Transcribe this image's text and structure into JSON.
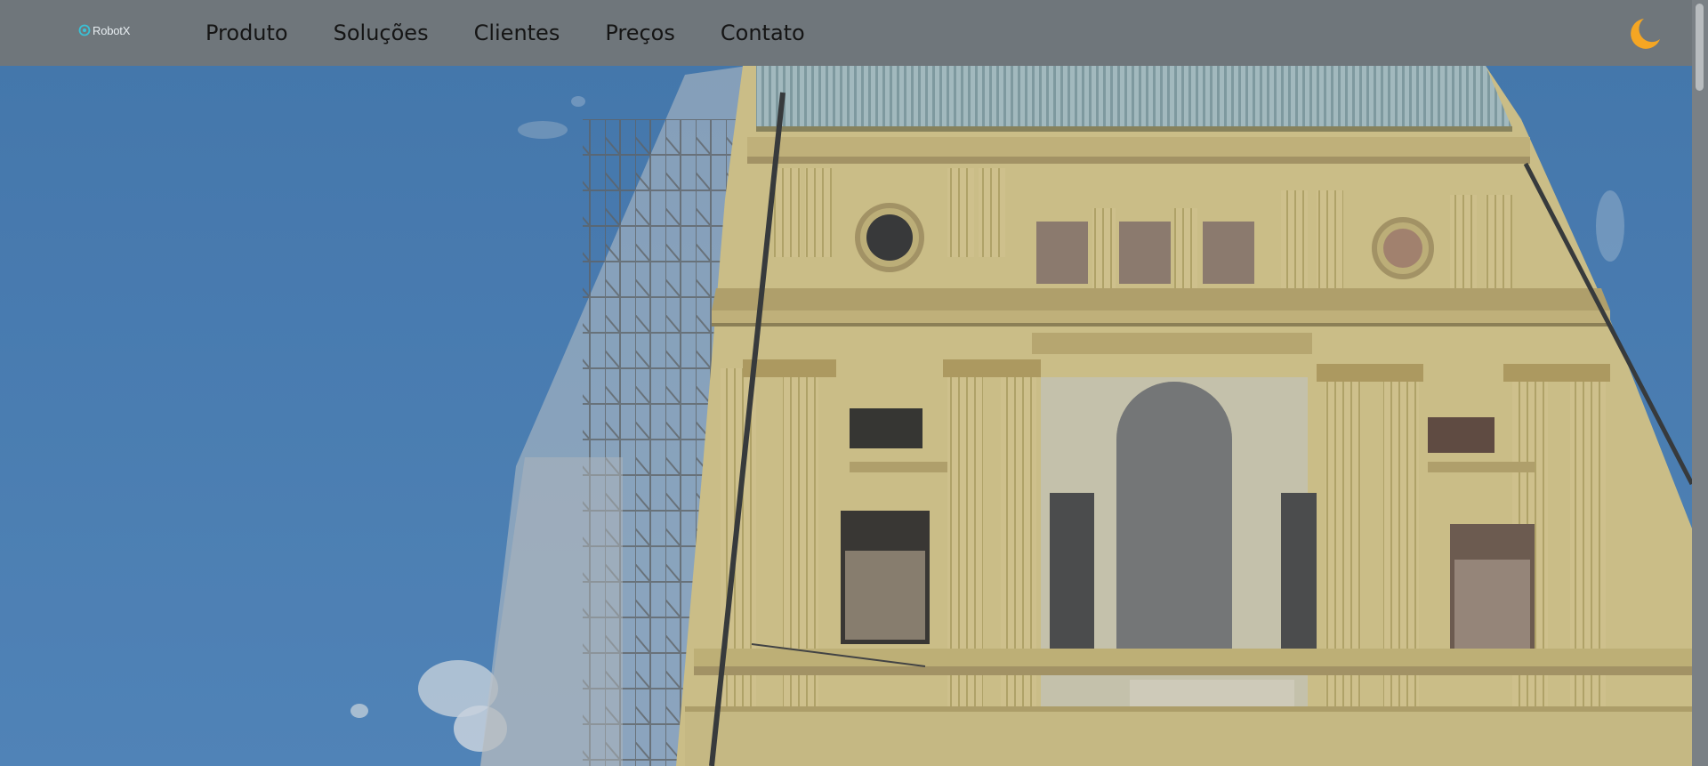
{
  "brand": {
    "name": "RobotX",
    "accent_color": "#39c1d6"
  },
  "nav": {
    "items": [
      {
        "label": "Produto"
      },
      {
        "label": "Soluções"
      },
      {
        "label": "Clientes"
      },
      {
        "label": "Preços"
      },
      {
        "label": "Contato"
      }
    ]
  },
  "theme_toggle": {
    "icon": "moon-icon",
    "color": "#f5a623"
  },
  "hero": {
    "image": "historic-building-facade-under-restoration"
  },
  "colors": {
    "navbar": "#6f767b",
    "sky": "#3f7ab8",
    "facade": "#d9c98a"
  }
}
